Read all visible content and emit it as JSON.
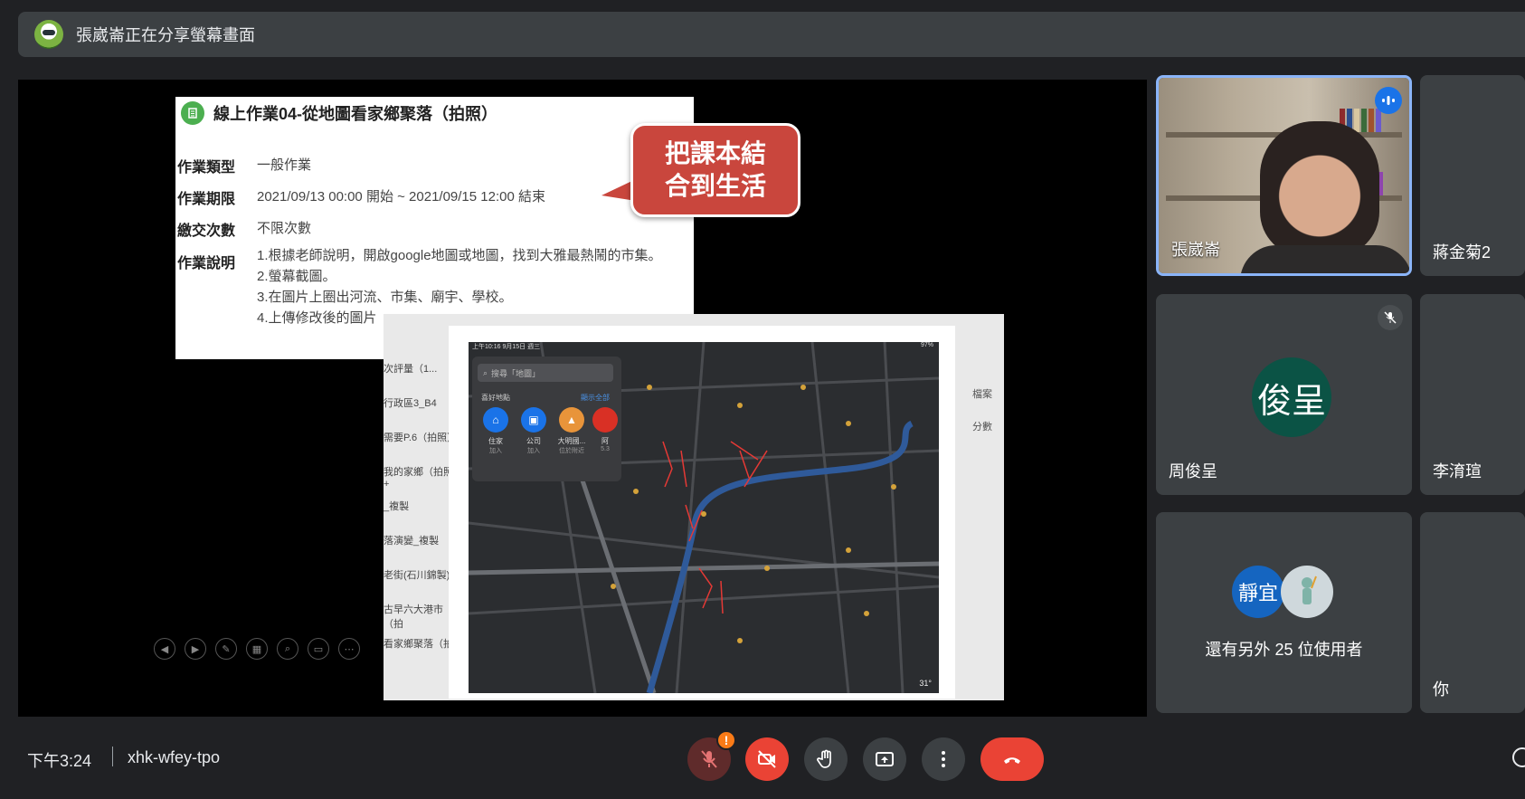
{
  "banner": {
    "text": "張崴崙正在分享螢幕畫面"
  },
  "slide": {
    "title": "線上作業04-從地圖看家鄉聚落（拍照）",
    "fields": [
      {
        "label": "作業類型",
        "value": "一般作業"
      },
      {
        "label": "作業期限",
        "value": "2021/09/13 00:00 開始 ~ 2021/09/15 12:00 結束"
      },
      {
        "label": "繳交次數",
        "value": "不限次數"
      },
      {
        "label": "作業說明",
        "lines": [
          "1.根據老師說明，開啟google地圖或地圖，找到大雅最熱鬧的市集。",
          "2.螢幕截圖。",
          "3.在圖片上圈出河流、市集、廟宇、學校。",
          "4.上傳修改後的圖片"
        ]
      }
    ],
    "callout_lines": [
      "把課本結",
      "合到生活"
    ]
  },
  "background_list": [
    "次評量（1...",
    "行政區3_B4",
    "需要P.6（拍照）",
    "我的家鄉（拍照+",
    "_複製",
    "落演變_複製",
    "老街(石川錦製)",
    "古早六大港市（拍",
    "看家鄉聚落（拍"
  ],
  "background_right": [
    "分數",
    "檔案"
  ],
  "map": {
    "status_left": "上午10:16 9月15日 週三",
    "status_right": "97%",
    "search_placeholder": "搜尋「地圖」",
    "favorites_title": "喜好地點",
    "favorites_all": "顯示全部",
    "favorites": [
      {
        "label": "住家",
        "sub": "加入",
        "color": "#1a73e8"
      },
      {
        "label": "公司",
        "sub": "加入",
        "color": "#1a73e8"
      },
      {
        "label": "大明國...",
        "sub": "位於附近",
        "color": "#e8943a"
      },
      {
        "label": "阿",
        "sub": "5.3",
        "color": "#d93025"
      }
    ],
    "temperature": "31°"
  },
  "participants": [
    {
      "name": "張崴崙",
      "speaking": true
    },
    {
      "name": "蔣金菊2"
    },
    {
      "name": "周俊呈",
      "initials": "俊呈",
      "muted": true
    },
    {
      "name": "李淯瑄"
    },
    {
      "others_text": "還有另外 25 位使用者",
      "avatar_initials": "靜宜"
    },
    {
      "name": "你"
    }
  ],
  "bottom": {
    "time": "下午3:24",
    "meeting_code": "xhk-wfey-tpo",
    "warning_badge": "!"
  },
  "colors": {
    "end_call": "#ea4335",
    "speaking_border": "#8ab4f8",
    "callout": "#c9463d"
  }
}
